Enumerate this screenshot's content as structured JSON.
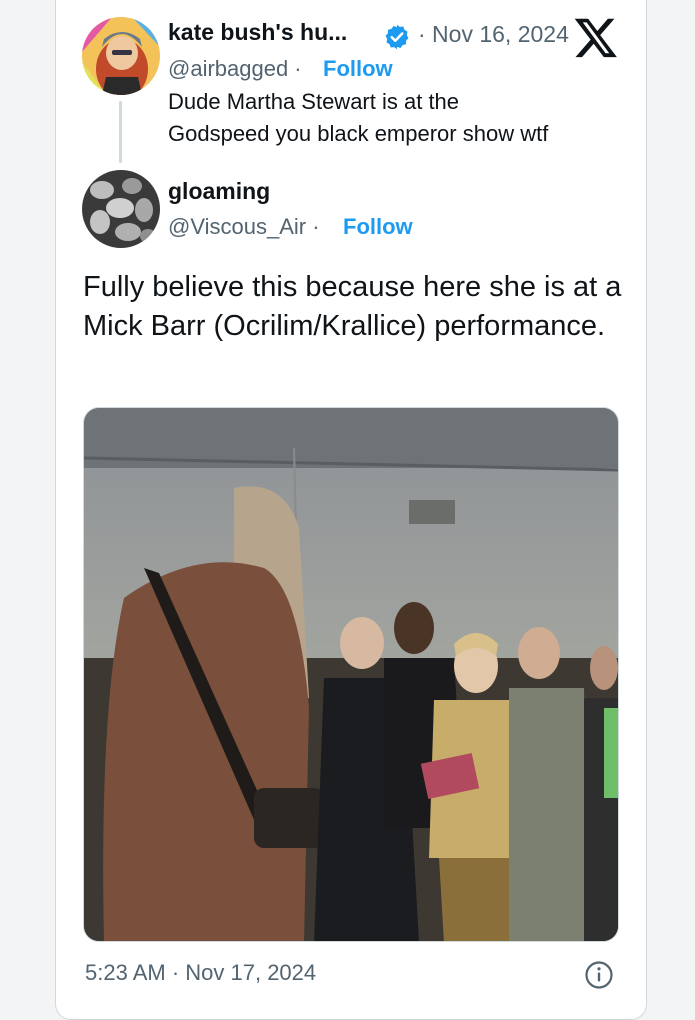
{
  "parent_tweet": {
    "display_name": "kate bush's hu...",
    "date": "· Nov 16, 2024",
    "handle": "@airbagged ·",
    "follow_label": "Follow",
    "text_line1": "Dude Martha Stewart is at the",
    "text_line2": "Godspeed you black emperor show wtf"
  },
  "reply_tweet": {
    "display_name": "gloaming",
    "handle": "@Viscous_Air ·",
    "follow_label": "Follow",
    "text": "Fully believe this because here she is at a Mick Barr (Ocrilim/Krallice) performance.",
    "timestamp": "5:23 AM · Nov 17, 2024"
  },
  "icons": {
    "platform_logo": "x-logo-icon",
    "verified": "verified-badge-icon",
    "info": "info-icon"
  },
  "colors": {
    "accent": "#1d9bf0",
    "text": "#0f1419",
    "secondary_text": "#536471",
    "border": "#cfd9de"
  }
}
